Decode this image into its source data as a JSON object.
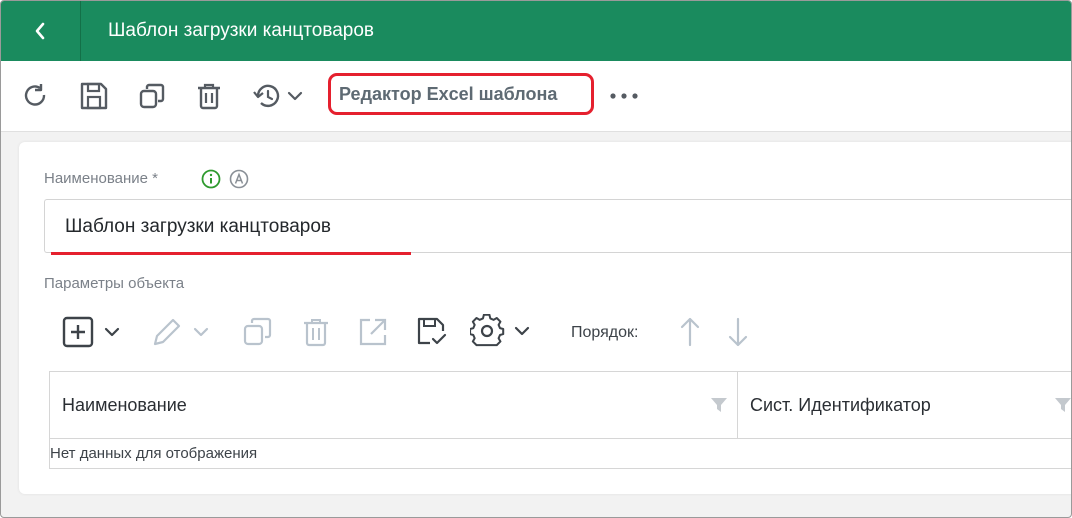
{
  "titlebar": {
    "title": "Шаблон загрузки канцтоваров",
    "back_icon": "chevron-left-icon",
    "color": "#1a8b5e"
  },
  "toolbar": {
    "icons": [
      "refresh-icon",
      "save-icon",
      "copy-icon",
      "delete-icon",
      "history-icon"
    ],
    "excel_editor_label": "Редактор Excel шаблона",
    "more_icon": "more-horizontal-icon",
    "highlight_color": "#e5202e"
  },
  "form": {
    "name_label": "Наименование *",
    "name_value": "Шаблон загрузки канцтоваров",
    "params_label": "Параметры объекта",
    "order_label": "Порядок:"
  },
  "grid": {
    "columns": [
      "Наименование",
      "Сист. Идентификатор"
    ],
    "empty_text": "Нет данных для отображения"
  }
}
